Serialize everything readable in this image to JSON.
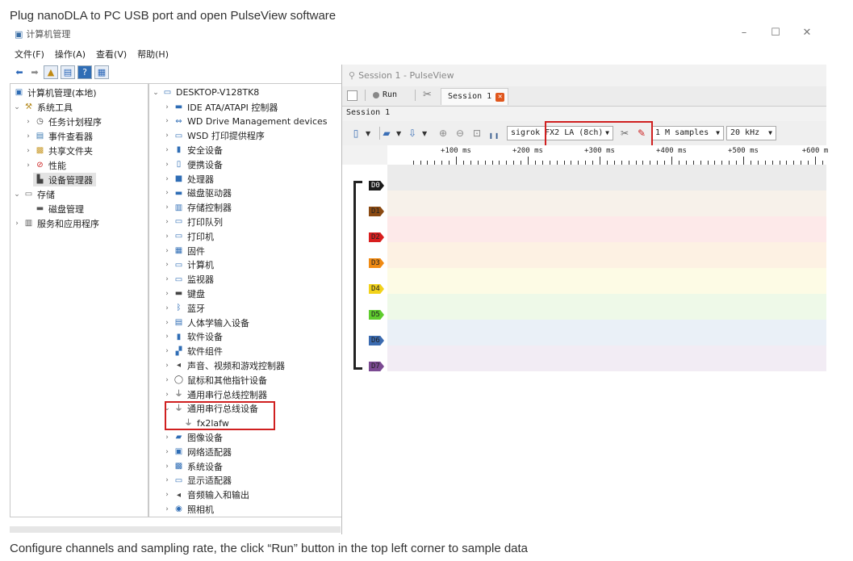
{
  "captions": {
    "top": "Plug nanoDLA to PC USB port and open PulseView software",
    "bottom": "Configure channels and sampling rate, the click “Run” button in the top left corner to sample data"
  },
  "computer_management": {
    "title": "计算机管理",
    "menu": [
      "文件(F)",
      "操作(A)",
      "查看(V)",
      "帮助(H)"
    ],
    "left_tree": [
      {
        "label": "计算机管理(本地)",
        "icon": "computer-mgmt-icon"
      },
      {
        "label": "系统工具",
        "icon": "tools-icon"
      },
      {
        "label": "任务计划程序",
        "icon": "clock-icon"
      },
      {
        "label": "事件查看器",
        "icon": "event-viewer-icon"
      },
      {
        "label": "共享文件夹",
        "icon": "shared-folder-icon"
      },
      {
        "label": "性能",
        "icon": "performance-icon"
      },
      {
        "label": "设备管理器",
        "icon": "device-manager-icon"
      },
      {
        "label": "存储",
        "icon": "storage-icon"
      },
      {
        "label": "磁盘管理",
        "icon": "disk-icon"
      },
      {
        "label": "服务和应用程序",
        "icon": "services-icon"
      }
    ],
    "device_tree_root": "DESKTOP-V128TK8",
    "devices": [
      {
        "label": "IDE ATA/ATAPI 控制器",
        "icon": "ide-icon"
      },
      {
        "label": "WD Drive Management devices",
        "icon": "wd-icon"
      },
      {
        "label": "WSD 打印提供程序",
        "icon": "printer-icon"
      },
      {
        "label": "安全设备",
        "icon": "security-icon"
      },
      {
        "label": "便携设备",
        "icon": "portable-icon"
      },
      {
        "label": "处理器",
        "icon": "cpu-icon"
      },
      {
        "label": "磁盘驱动器",
        "icon": "disk-drive-icon"
      },
      {
        "label": "存储控制器",
        "icon": "storage-controller-icon"
      },
      {
        "label": "打印队列",
        "icon": "print-queue-icon"
      },
      {
        "label": "打印机",
        "icon": "printer-icon"
      },
      {
        "label": "固件",
        "icon": "firmware-icon"
      },
      {
        "label": "计算机",
        "icon": "computer-icon"
      },
      {
        "label": "监视器",
        "icon": "monitor-icon"
      },
      {
        "label": "键盘",
        "icon": "keyboard-icon"
      },
      {
        "label": "蓝牙",
        "icon": "bluetooth-icon"
      },
      {
        "label": "人体学输入设备",
        "icon": "hid-icon"
      },
      {
        "label": "软件设备",
        "icon": "software-device-icon"
      },
      {
        "label": "软件组件",
        "icon": "software-component-icon"
      },
      {
        "label": "声音、视频和游戏控制器",
        "icon": "sound-icon"
      },
      {
        "label": "鼠标和其他指针设备",
        "icon": "mouse-icon"
      },
      {
        "label": "通用串行总线控制器",
        "icon": "usb-icon"
      },
      {
        "label": "通用串行总线设备",
        "icon": "usb-icon"
      },
      {
        "label": "fx2lafw",
        "icon": "usb-icon"
      },
      {
        "label": "图像设备",
        "icon": "camera-icon"
      },
      {
        "label": "网络适配器",
        "icon": "network-icon"
      },
      {
        "label": "系统设备",
        "icon": "system-icon"
      },
      {
        "label": "显示适配器",
        "icon": "display-adapter-icon"
      },
      {
        "label": "音频输入和输出",
        "icon": "audio-icon"
      },
      {
        "label": "照相机",
        "icon": "webcam-icon"
      }
    ]
  },
  "pulseview": {
    "title": "Session 1 - PulseView",
    "run_label": "Run",
    "tab_label": "Session 1",
    "session_label": "Session 1",
    "device": "sigrok FX2 LA (8ch)",
    "samples": "1 M samples",
    "rate": "20 kHz",
    "ruler_labels": [
      "+100 ms",
      "+200 ms",
      "+300 ms",
      "+400 ms",
      "+500 ms",
      "+600 m"
    ],
    "channels": [
      {
        "name": "D0",
        "color": "#1a1a1a",
        "band": "#ebebeb"
      },
      {
        "name": "D1",
        "color": "#8b4a12",
        "band": "#f7f1ea"
      },
      {
        "name": "D2",
        "color": "#d81e1e",
        "band": "#fde9e9"
      },
      {
        "name": "D3",
        "color": "#f08a12",
        "band": "#fdf1e3"
      },
      {
        "name": "D4",
        "color": "#f2d21a",
        "band": "#fdfbe5"
      },
      {
        "name": "D5",
        "color": "#5fcd2e",
        "band": "#eef9e8"
      },
      {
        "name": "D6",
        "color": "#3b6bb0",
        "band": "#eaf0f7"
      },
      {
        "name": "D7",
        "color": "#7b4a92",
        "band": "#f2ecf4"
      }
    ]
  }
}
